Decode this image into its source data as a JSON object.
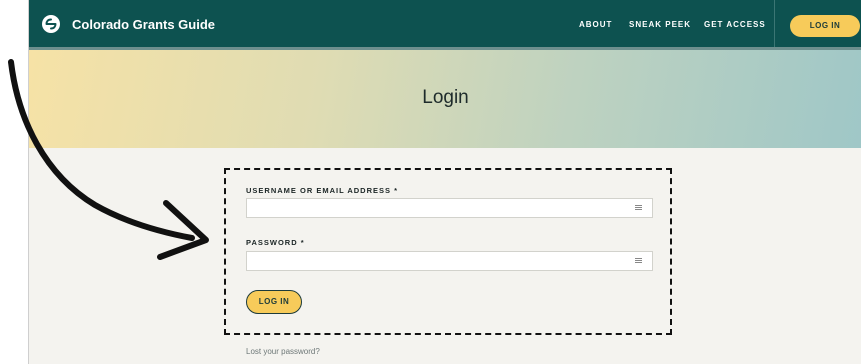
{
  "site": {
    "brand_name": "Colorado Grants Guide",
    "nav": {
      "items": [
        "ABOUT",
        "SNEAK PEEK",
        "GET ACCESS"
      ],
      "login_button": "LOG IN"
    },
    "hero": {
      "title": "Login"
    },
    "form": {
      "username_label": "USERNAME OR EMAIL ADDRESS *",
      "username_value": "",
      "password_label": "PASSWORD *",
      "password_value": "",
      "submit_label": "LOG IN",
      "lost_password_link": "Lost your password?"
    }
  },
  "colors": {
    "nav_background": "#0d5250",
    "accent_yellow": "#f7cb5a",
    "page_background": "#f4f3ef",
    "annotation": "#111111"
  },
  "icons": {
    "brand": "brand-logo-icon",
    "input_autofill": "key-icon",
    "annotation_arrow": "curved-arrow-icon"
  }
}
